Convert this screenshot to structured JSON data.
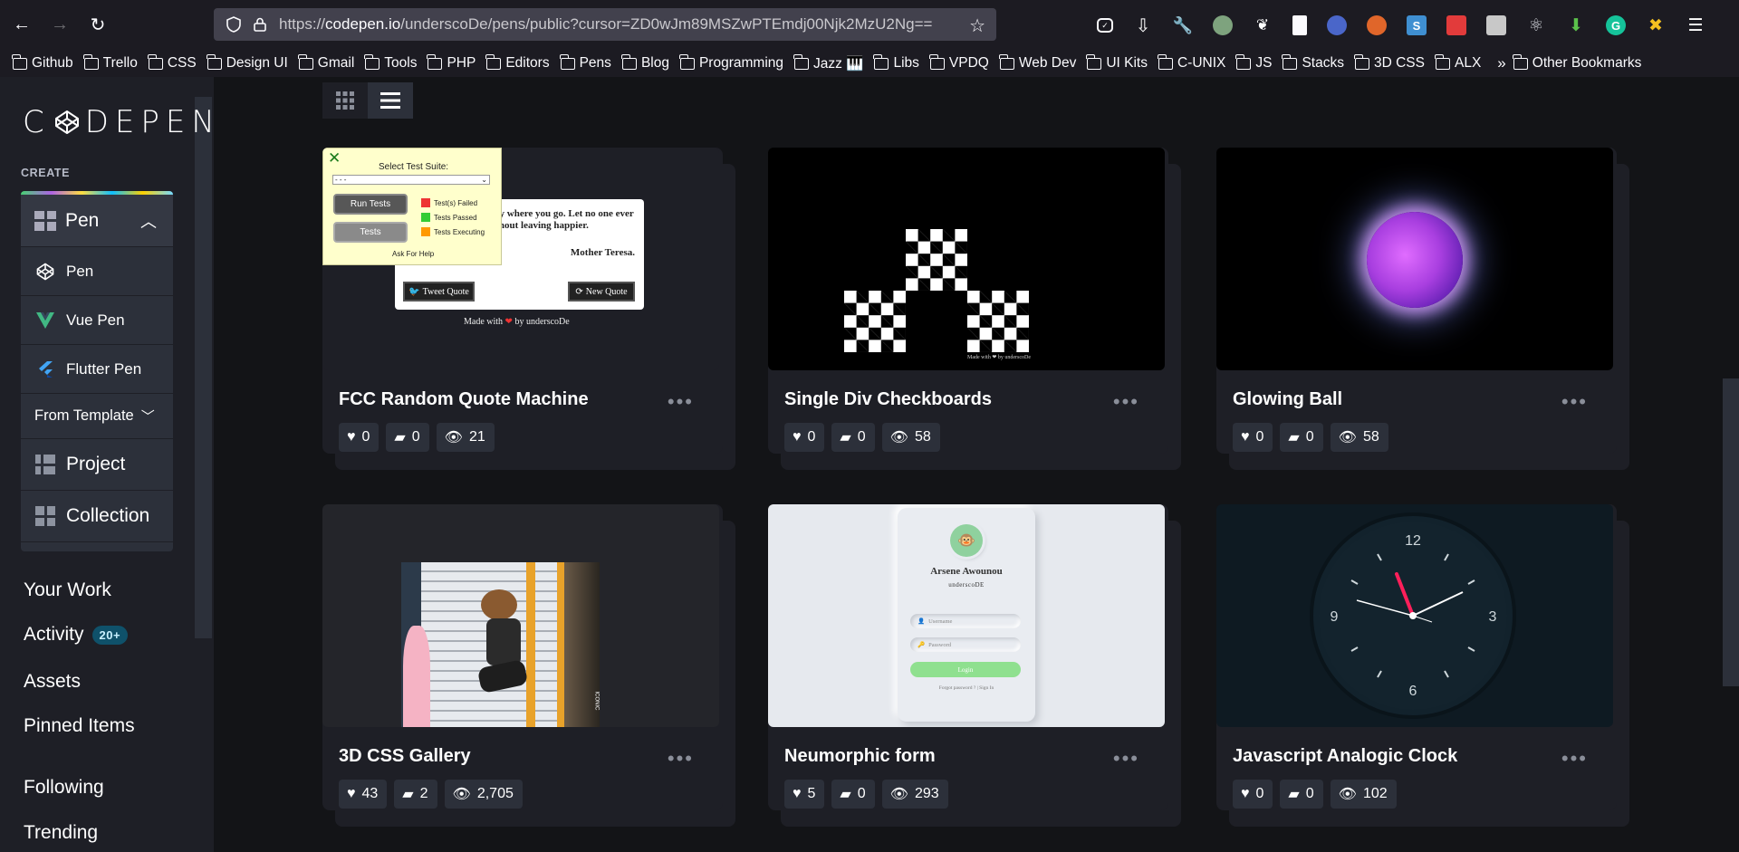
{
  "browser": {
    "url_prefix": "https://",
    "url_domain": "codepen.io",
    "url_path": "/underscoDe/pens/public?cursor=ZD0wJm89MSZwPTEmdj00Njk2MzU2Ng==",
    "bookmarks": [
      "Github",
      "Trello",
      "CSS",
      "Design UI",
      "Gmail",
      "Tools",
      "PHP",
      "Editors",
      "Pens",
      "Blog",
      "Programming",
      "Jazz 🎹",
      "Libs",
      "VPDQ",
      "Web Dev",
      "UI Kits",
      "C-UNIX",
      "JS",
      "Stacks",
      "3D CSS",
      "ALX"
    ],
    "other_bookmarks": "Other Bookmarks"
  },
  "sidebar": {
    "logo": "CODEPEN",
    "create_label": "CREATE",
    "pen_header": "Pen",
    "create_items": [
      "Pen",
      "Vue Pen",
      "Flutter Pen"
    ],
    "from_template": "From Template",
    "project": "Project",
    "collection": "Collection",
    "your_work": "Your Work",
    "activity": "Activity",
    "activity_badge": "20+",
    "assets": "Assets",
    "pinned_items": "Pinned Items",
    "following": "Following",
    "trending": "Trending"
  },
  "cards": [
    {
      "title": "FCC Random Quote Machine",
      "likes": "0",
      "comments": "0",
      "views": "21"
    },
    {
      "title": "Single Div Checkboards",
      "likes": "0",
      "comments": "0",
      "views": "58"
    },
    {
      "title": "Glowing Ball",
      "likes": "0",
      "comments": "0",
      "views": "58"
    },
    {
      "title": "3D CSS Gallery",
      "likes": "43",
      "comments": "2",
      "views": "2,705"
    },
    {
      "title": "Neumorphic form",
      "likes": "5",
      "comments": "0",
      "views": "293"
    },
    {
      "title": "Javascript Analogic Clock",
      "likes": "0",
      "comments": "0",
      "views": "102"
    }
  ],
  "previews": {
    "fcc": {
      "select_label": "Select Test Suite:",
      "select_value": "- - -",
      "run_tests": "Run Tests",
      "tests": "Tests",
      "legend": [
        "Test(s) Failed",
        "Tests Passed",
        "Tests Executing"
      ],
      "help": "Ask For Help",
      "quote_line1": "...very where you go. Let no one ever",
      "quote_line2": "...without leaving happier.",
      "author": "Mother Teresa.",
      "tweet": "Tweet Quote",
      "new_quote": "New Quote",
      "made_with_prefix": "Made with",
      "made_with_suffix": "by underscoDe"
    },
    "checker_credit": "Made with ❤ by underscoDe",
    "neumorphic": {
      "name": "Arsene Awounou",
      "handle": "underscoDE",
      "username_ph": "Username",
      "password_ph": "Password",
      "login": "Login",
      "links": "Forgot password ? | Sign In"
    },
    "clock": {
      "n12": "12",
      "n3": "3",
      "n6": "6",
      "n9": "9"
    },
    "gallery_tag": "ICONIC"
  },
  "colors": {
    "bg": "#131417",
    "sidebar": "#1e1f26",
    "card": "#1e1f26",
    "stat": "#2c303a",
    "badge": "#0f516a",
    "clock_hand": "#ff1f5a"
  }
}
